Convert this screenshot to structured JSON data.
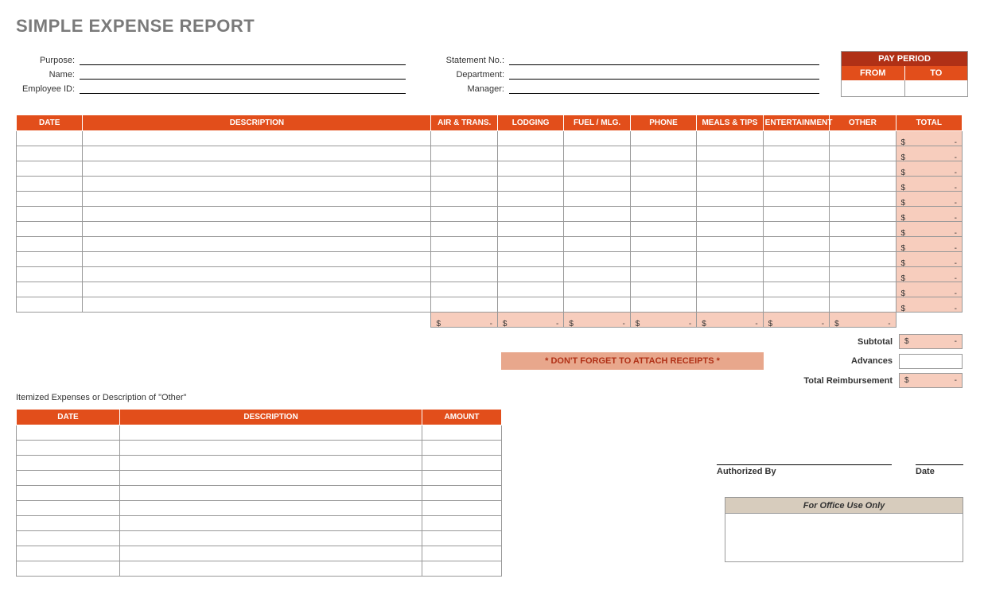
{
  "title": "SIMPLE EXPENSE REPORT",
  "fields_left": {
    "purpose": "Purpose:",
    "name": "Name:",
    "employee_id": "Employee ID:"
  },
  "fields_right": {
    "statement_no": "Statement No.:",
    "department": "Department:",
    "manager": "Manager:"
  },
  "pay_period": {
    "header": "PAY PERIOD",
    "from": "FROM",
    "to": "TO"
  },
  "main_headers": {
    "date": "DATE",
    "description": "DESCRIPTION",
    "air": "AIR & TRANS.",
    "lodging": "LODGING",
    "fuel": "FUEL / MLG.",
    "phone": "PHONE",
    "meals": "MEALS & TIPS",
    "entertainment": "ENTERTAINMENT",
    "other": "OTHER",
    "total": "TOTAL"
  },
  "currency": "$",
  "dash": "-",
  "receipt_note": "* DON'T FORGET TO ATTACH RECEIPTS *",
  "summary": {
    "subtotal": "Subtotal",
    "advances": "Advances",
    "total_reimbursement": "Total Reimbursement"
  },
  "itemized": {
    "title": "Itemized Expenses or Description of \"Other\"",
    "date": "DATE",
    "description": "DESCRIPTION",
    "amount": "AMOUNT"
  },
  "signatures": {
    "authorized_by": "Authorized By",
    "date": "Date"
  },
  "office_use": "For Office Use Only"
}
